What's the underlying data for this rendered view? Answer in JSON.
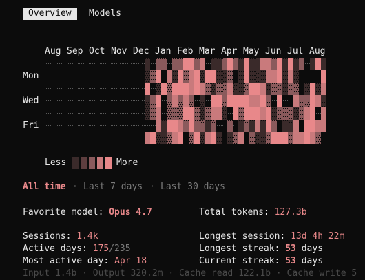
{
  "tabs": [
    {
      "label": "Overview",
      "active": true
    },
    {
      "label": "Models",
      "active": false
    }
  ],
  "heatmap": {
    "months": [
      "Aug",
      "Sep",
      "Oct",
      "Nov",
      "Dec",
      "Jan",
      "Feb",
      "Mar",
      "Apr",
      "May",
      "Jun",
      "Jul",
      "Aug"
    ],
    "day_labels": [
      "Mon",
      "Wed",
      "Fri"
    ],
    "legend_less": "Less",
    "legend_more": "More",
    "colors": {
      "empty_dot": "#5a5a5a",
      "level1": "#3a2a2a",
      "level2": "#8a5a5c",
      "level3": "#c97a7c",
      "level4": "#e8888a"
    }
  },
  "range": {
    "items": [
      "All time",
      "Last 7 days",
      "Last 30 days"
    ],
    "separator": "·",
    "selected": "All time"
  },
  "stats": {
    "favorite_model_label": "Favorite model:",
    "favorite_model_value": "Opus 4.7",
    "total_tokens_label": "Total tokens:",
    "total_tokens_value": "127.3b",
    "sessions_label": "Sessions:",
    "sessions_value": "1.4k",
    "longest_session_label": "Longest session:",
    "longest_session_value": "13d 4h 22m",
    "active_days_label": "Active days:",
    "active_days_value": "175",
    "active_days_total": "/235",
    "longest_streak_label": "Longest streak:",
    "longest_streak_value": "53",
    "longest_streak_unit": "days",
    "most_active_day_label": "Most active day:",
    "most_active_day_value": "Apr 18",
    "current_streak_label": "Current streak:",
    "current_streak_value": "53",
    "current_streak_unit": "days"
  },
  "footer_line": "Input 1.4b · Output 320.2m · Cache read 122.1b · Cache write 5"
}
